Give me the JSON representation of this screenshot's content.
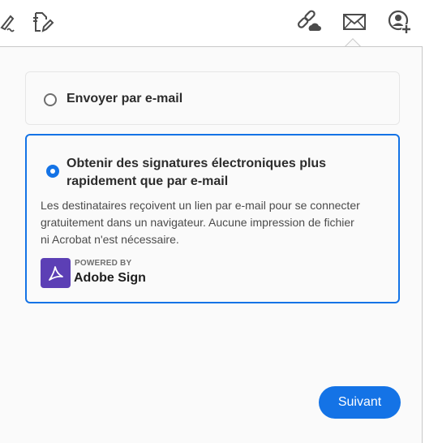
{
  "toolbar": {
    "icons": [
      "signature-icon",
      "edit-document-icon",
      "share-link-icon",
      "mail-icon",
      "add-user-icon"
    ]
  },
  "options": {
    "email": {
      "label": "Envoyer par e-mail",
      "selected": false
    },
    "sign": {
      "title_line1": "Obtenir des signatures électroniques plus",
      "title_line2": "rapidement que par e-mail",
      "description_line1": "Les destinataires reçoivent un lien par e-mail pour se connecter",
      "description_line2": "gratuitement dans un navigateur. Aucune impression de fichier",
      "description_line3": "ni Acrobat n'est nécessaire.",
      "powered_by": "POWERED BY",
      "brand": "Adobe Sign",
      "selected": true
    }
  },
  "footer": {
    "next_label": "Suivant"
  },
  "colors": {
    "accent": "#1473e6",
    "brand": "#5c3fb5",
    "panel_bg": "#fafafa"
  }
}
